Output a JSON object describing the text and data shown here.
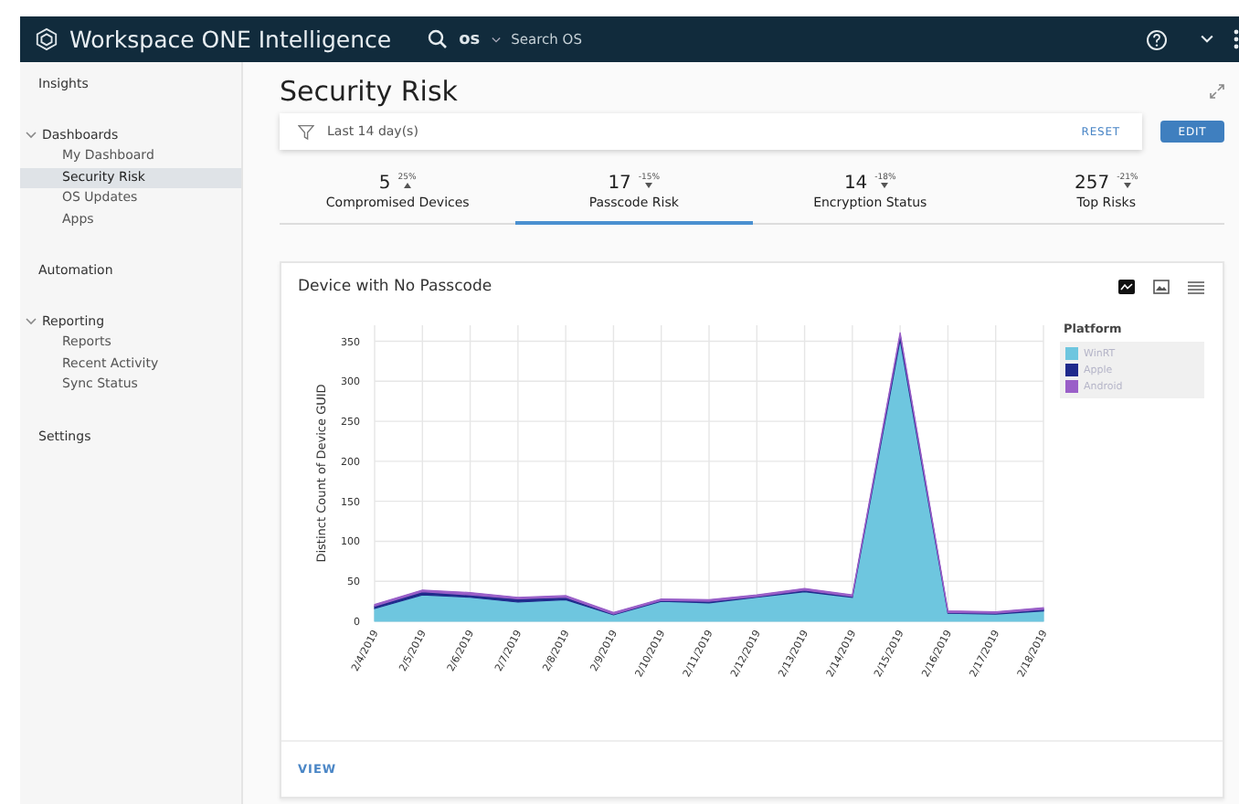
{
  "header": {
    "product": "Workspace ONE Intelligence",
    "scope": "os",
    "search_placeholder": "Search OS"
  },
  "sidebar": {
    "items": [
      {
        "label": "Insights",
        "selected": false
      },
      {
        "label": "Dashboards",
        "selected": false,
        "expanded": true,
        "children": [
          {
            "label": "My Dashboard",
            "selected": false
          },
          {
            "label": "Security Risk",
            "selected": true
          },
          {
            "label": "OS Updates",
            "selected": false
          },
          {
            "label": "Apps",
            "selected": false
          }
        ]
      },
      {
        "label": "Automation",
        "selected": false
      },
      {
        "label": "Reporting",
        "selected": false,
        "expanded": true,
        "children": [
          {
            "label": "Reports",
            "selected": false
          },
          {
            "label": "Recent Activity",
            "selected": false
          },
          {
            "label": "Sync Status",
            "selected": false
          }
        ]
      },
      {
        "label": "Settings",
        "selected": false
      }
    ]
  },
  "page": {
    "title": "Security Risk"
  },
  "filter": {
    "text": "Last 14 day(s)",
    "reset": "RESET",
    "edit": "EDIT"
  },
  "tabs": [
    {
      "value": "5",
      "change": "25%",
      "rising": true,
      "label": "Compromised Devices",
      "selected": false
    },
    {
      "value": "17",
      "change": "-15%",
      "rising": false,
      "label": "Passcode Risk",
      "selected": true
    },
    {
      "value": "14",
      "change": "-18%",
      "rising": false,
      "label": "Encryption Status",
      "selected": false
    },
    {
      "value": "257",
      "change": "-21%",
      "rising": false,
      "label": "Top Risks",
      "selected": false
    }
  ],
  "card": {
    "title": "Device with No Passcode",
    "legend_title": "Platform",
    "footer_link": "VIEW",
    "chart_data": {
      "type": "area",
      "stacked": true,
      "grid": true,
      "ylabel": "Distinct Count of Device GUID",
      "categories": [
        "2/4/2019",
        "2/5/2019",
        "2/6/2019",
        "2/7/2019",
        "2/8/2019",
        "2/9/2019",
        "2/10/2019",
        "2/11/2019",
        "2/12/2019",
        "2/13/2019",
        "2/14/2019",
        "2/15/2019",
        "2/16/2019",
        "2/17/2019",
        "2/18/2019"
      ],
      "ylim": [
        0,
        370
      ],
      "yticks": [
        0,
        50,
        100,
        150,
        200,
        250,
        300,
        350
      ],
      "series": [
        {
          "name": "WinRT",
          "color": "#6ec6df",
          "values": [
            16,
            33,
            30,
            24,
            27,
            8,
            25,
            23,
            30,
            37,
            30,
            352,
            10,
            9,
            13
          ]
        },
        {
          "name": "Apple",
          "color": "#1f2a8c",
          "values": [
            3,
            4,
            3,
            4,
            3,
            1,
            1,
            2,
            1,
            2,
            1,
            6,
            1,
            1,
            2
          ]
        },
        {
          "name": "Android",
          "color": "#9a5fc8",
          "values": [
            2,
            2,
            3,
            2,
            2,
            2,
            2,
            2,
            2,
            2,
            2,
            3,
            2,
            2,
            2
          ]
        }
      ]
    }
  }
}
